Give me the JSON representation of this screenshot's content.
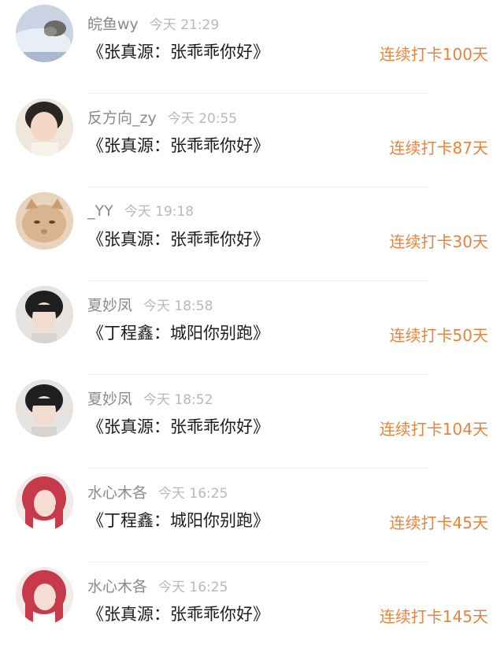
{
  "items": [
    {
      "username": "皖鱼wy",
      "time": "今天 21:29",
      "book": "《张真源：张乖乖你好》",
      "streak": "连续打卡100天",
      "avatar": "avatar-snowy-animal-icon"
    },
    {
      "username": "反方向_zy",
      "time": "今天 20:55",
      "book": "《张真源：张乖乖你好》",
      "streak": "连续打卡87天",
      "avatar": "avatar-person-icon"
    },
    {
      "username": "_YY",
      "time": "今天 19:18",
      "book": "《张真源：张乖乖你好》",
      "streak": "连续打卡30天",
      "avatar": "avatar-cat-icon"
    },
    {
      "username": "夏妙凤",
      "time": "今天 18:58",
      "book": "《丁程鑫：城阳你别跑》",
      "streak": "连续打卡50天",
      "avatar": "avatar-boy-icon"
    },
    {
      "username": "夏妙凤",
      "time": "今天 18:52",
      "book": "《张真源：张乖乖你好》",
      "streak": "连续打卡104天",
      "avatar": "avatar-boy-icon"
    },
    {
      "username": "水心木各",
      "time": "今天 16:25",
      "book": "《丁程鑫：城阳你别跑》",
      "streak": "连续打卡45天",
      "avatar": "avatar-red-hair-girl-icon"
    },
    {
      "username": "水心木各",
      "time": "今天 16:25",
      "book": "《张真源：张乖乖你好》",
      "streak": "连续打卡145天",
      "avatar": "avatar-red-hair-girl-icon"
    }
  ],
  "colors": {
    "streak": "#e8833a",
    "username": "#8a8a8a",
    "time": "#b8b8b8",
    "book": "#1c1c1c"
  }
}
